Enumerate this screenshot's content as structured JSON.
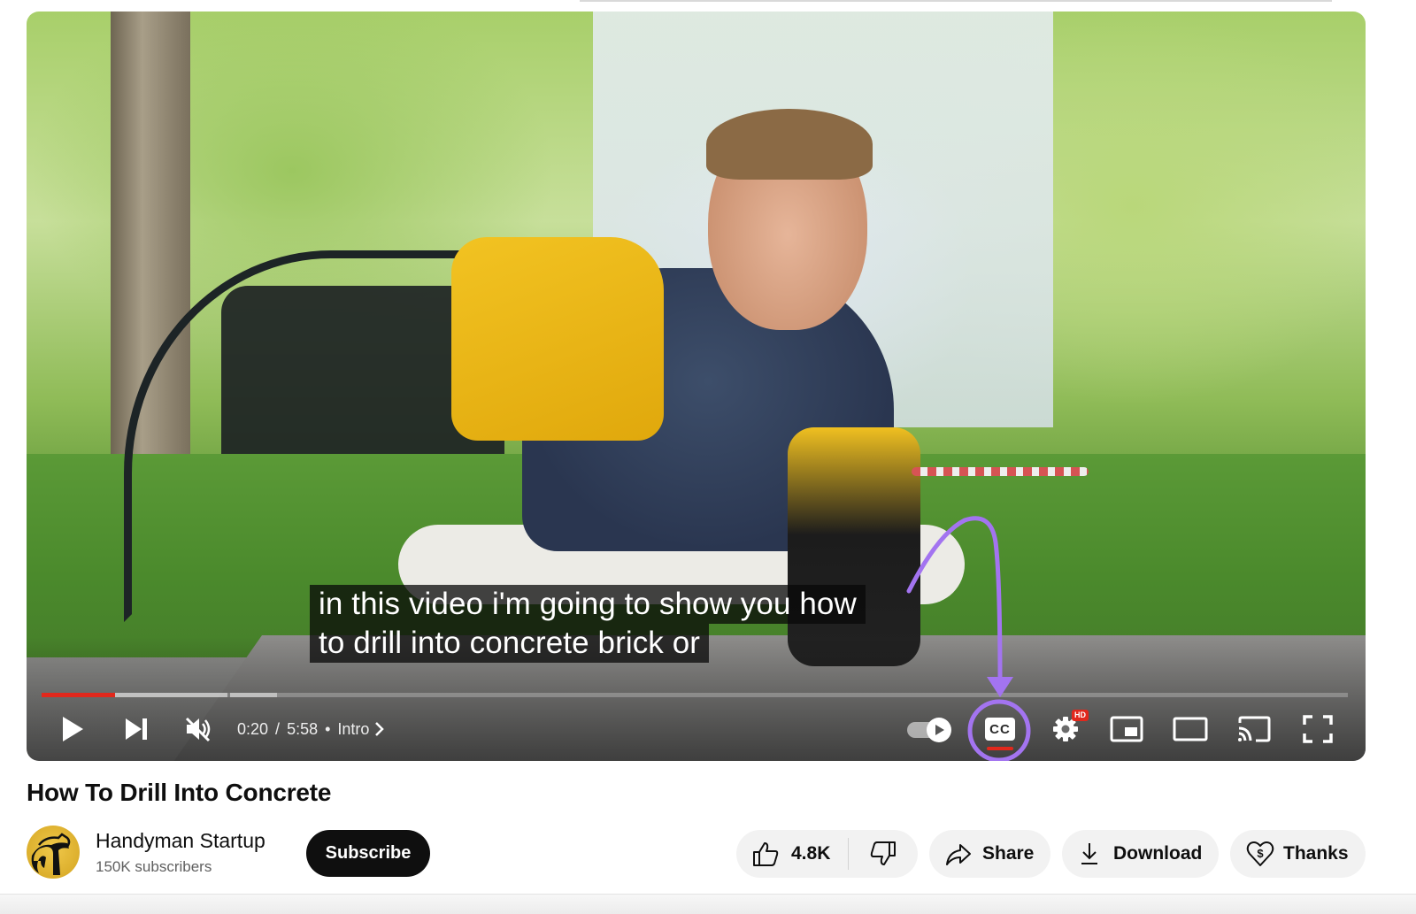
{
  "player": {
    "captions": {
      "line1": "in this video i'm going to show you how",
      "line2": "to drill into concrete brick or"
    },
    "progress": {
      "played_fraction": 0.056,
      "buffered_fraction": 0.18,
      "chapter_marker_fraction": 0.142,
      "played_color": "#e1281c"
    },
    "time": {
      "current": "0:20",
      "separator": "/",
      "duration": "5:58",
      "dot": "•",
      "chapter": "Intro"
    },
    "controls": {
      "play_icon": "play-icon",
      "next_icon": "next-icon",
      "mute_icon": "volume-muted-icon",
      "autoplay_icon": "autoplay-toggle-icon",
      "cc_label": "CC",
      "settings_icon": "gear-icon",
      "hd_badge": "HD",
      "miniplayer_icon": "miniplayer-icon",
      "theater_icon": "theater-mode-icon",
      "cast_icon": "cast-icon",
      "fullscreen_icon": "fullscreen-icon"
    },
    "annotation": {
      "color": "#a374f0",
      "target": "cc-button"
    }
  },
  "video": {
    "title": "How To Drill Into Concrete"
  },
  "channel": {
    "name": "Handyman Startup",
    "subscribers": "150K subscribers",
    "subscribe_label": "Subscribe"
  },
  "actions": {
    "like_count": "4.8K",
    "share_label": "Share",
    "download_label": "Download",
    "thanks_label": "Thanks"
  }
}
